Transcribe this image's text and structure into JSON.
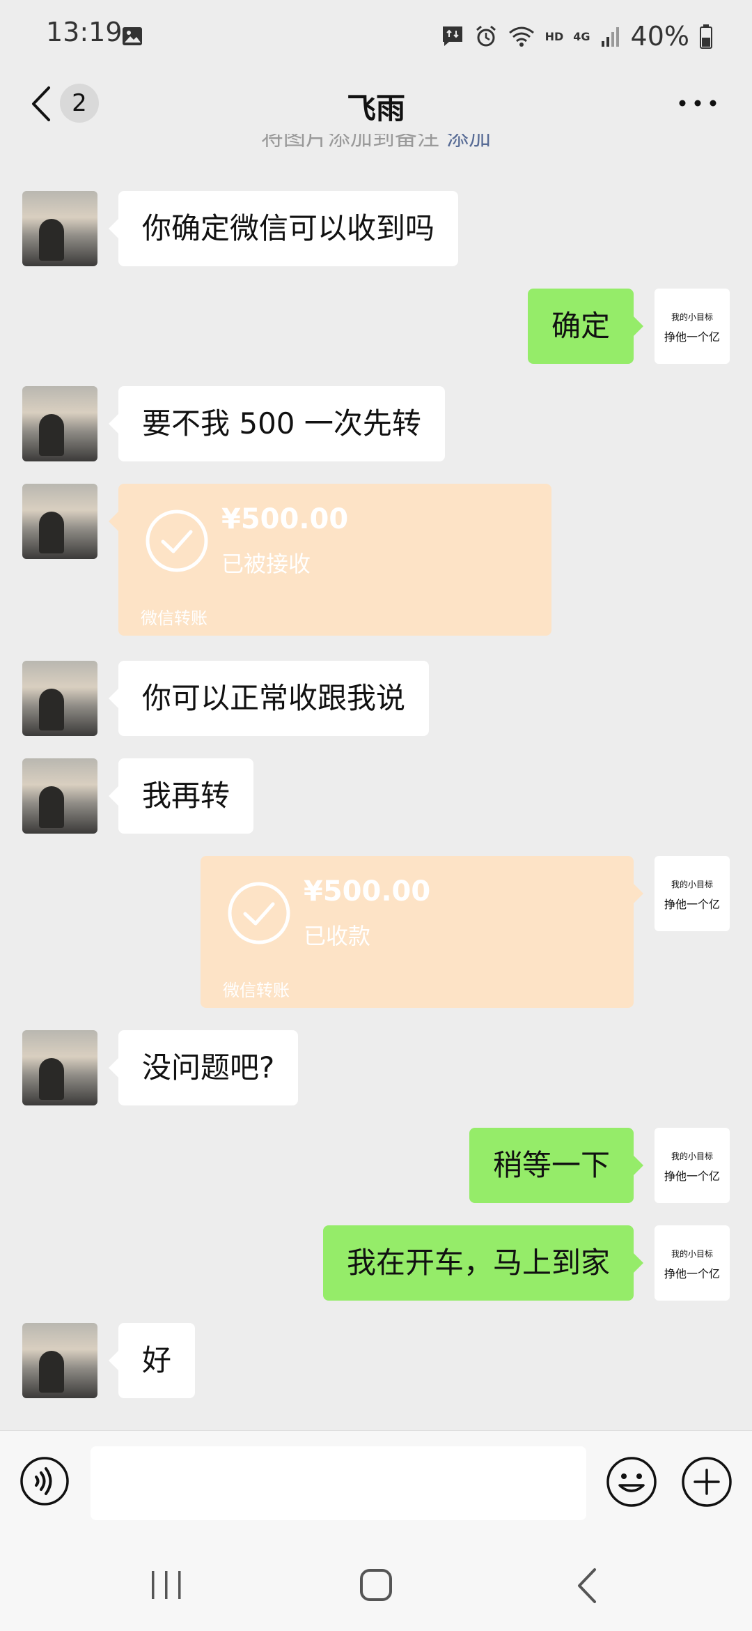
{
  "status_bar": {
    "time": "13:19",
    "network_hd": "HD",
    "network_4g": "4G",
    "battery": "40%"
  },
  "header": {
    "unread_count": "2",
    "title": "飞雨"
  },
  "system_hint": {
    "text": "将图片添加到备注",
    "link": "添加"
  },
  "messages": [
    {
      "side": "them",
      "text": "你确定微信可以收到吗"
    },
    {
      "side": "me",
      "text": "确定"
    },
    {
      "side": "them",
      "text": "要不我 500 一次先转"
    },
    {
      "side": "them",
      "type": "transfer",
      "amount": "¥500.00",
      "status": "已被接收",
      "label": "微信转账"
    },
    {
      "side": "them",
      "text": "你可以正常收跟我说"
    },
    {
      "side": "them",
      "text": "我再转"
    },
    {
      "side": "me",
      "type": "transfer",
      "amount": "¥500.00",
      "status": "已收款",
      "label": "微信转账"
    },
    {
      "side": "them",
      "text": "没问题吧?"
    },
    {
      "side": "me",
      "text": "稍等一下"
    },
    {
      "side": "me",
      "text": "我在开车，马上到家"
    },
    {
      "side": "them",
      "text": "好"
    }
  ],
  "my_avatar": {
    "line1": "我的小目标",
    "line2": "挣他一个亿"
  },
  "input": {
    "value": ""
  },
  "colors": {
    "background": "#ededed",
    "my_bubble": "#95ec69",
    "their_bubble": "#ffffff",
    "transfer_card": "#fde3c6",
    "link": "#576b95"
  }
}
